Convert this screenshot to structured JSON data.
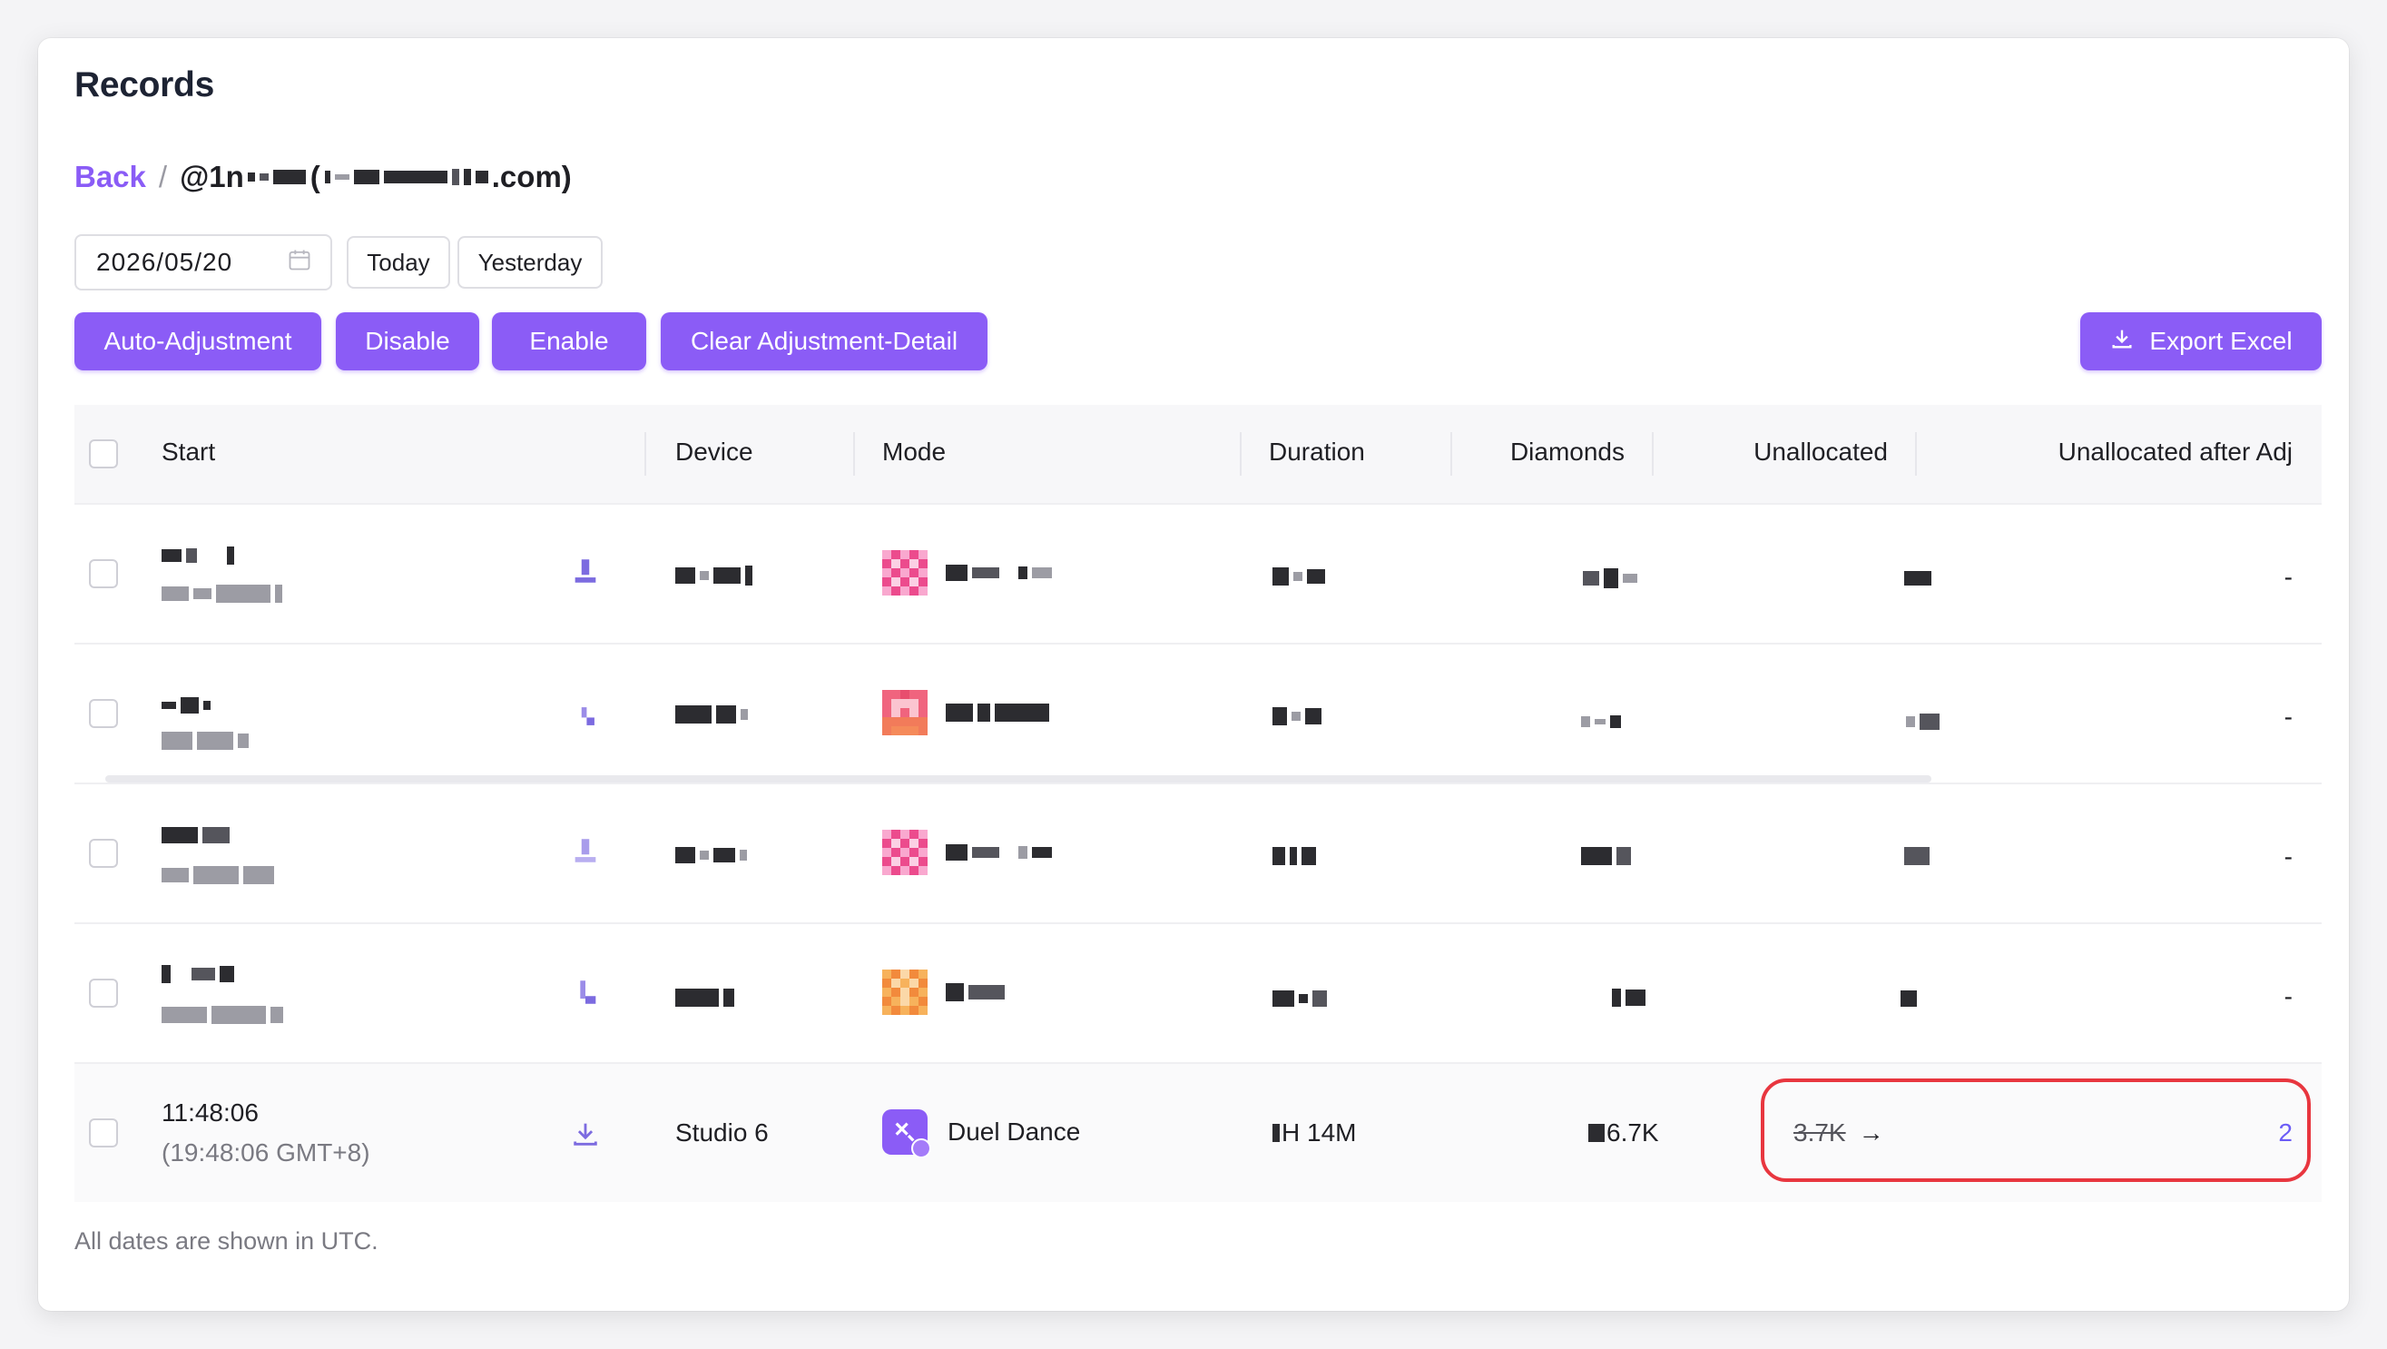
{
  "page": {
    "title": "Records",
    "footer_note": "All dates are shown in UTC."
  },
  "breadcrumb": {
    "back_label": "Back",
    "separator": "/",
    "user_prefix": "@1n",
    "user_suffix": ".com)"
  },
  "filters": {
    "date_value": "2026/05/20",
    "today_label": "Today",
    "yesterday_label": "Yesterday"
  },
  "actions": {
    "auto_adjustment": "Auto-Adjustment",
    "disable": "Disable",
    "enable": "Enable",
    "clear_adjustment": "Clear Adjustment-Detail",
    "export_excel": "Export Excel"
  },
  "table": {
    "columns": [
      "Start",
      "Device",
      "Mode",
      "Duration",
      "Diamonds",
      "Unallocated",
      "Unallocated after Adj"
    ],
    "redacted_rows": [
      {
        "after_adj": "-"
      },
      {
        "after_adj": "-"
      },
      {
        "after_adj": "-"
      },
      {
        "after_adj": "-"
      }
    ],
    "last_row": {
      "start_time": "11:48:06",
      "start_local": "(19:48:06 GMT+8)",
      "device": "Studio 6",
      "mode": "Duel Dance",
      "duration": "H 14M",
      "diamonds": "6.7K",
      "unallocated_old": "3.7K",
      "arrow": "→",
      "unallocated_after_adj": "2"
    }
  },
  "colors": {
    "accent": "#8b5cf6",
    "highlight": "#e8363f",
    "link": "#6b5cf6"
  },
  "icons": [
    "calendar-icon",
    "download-icon",
    "mode-icon"
  ]
}
